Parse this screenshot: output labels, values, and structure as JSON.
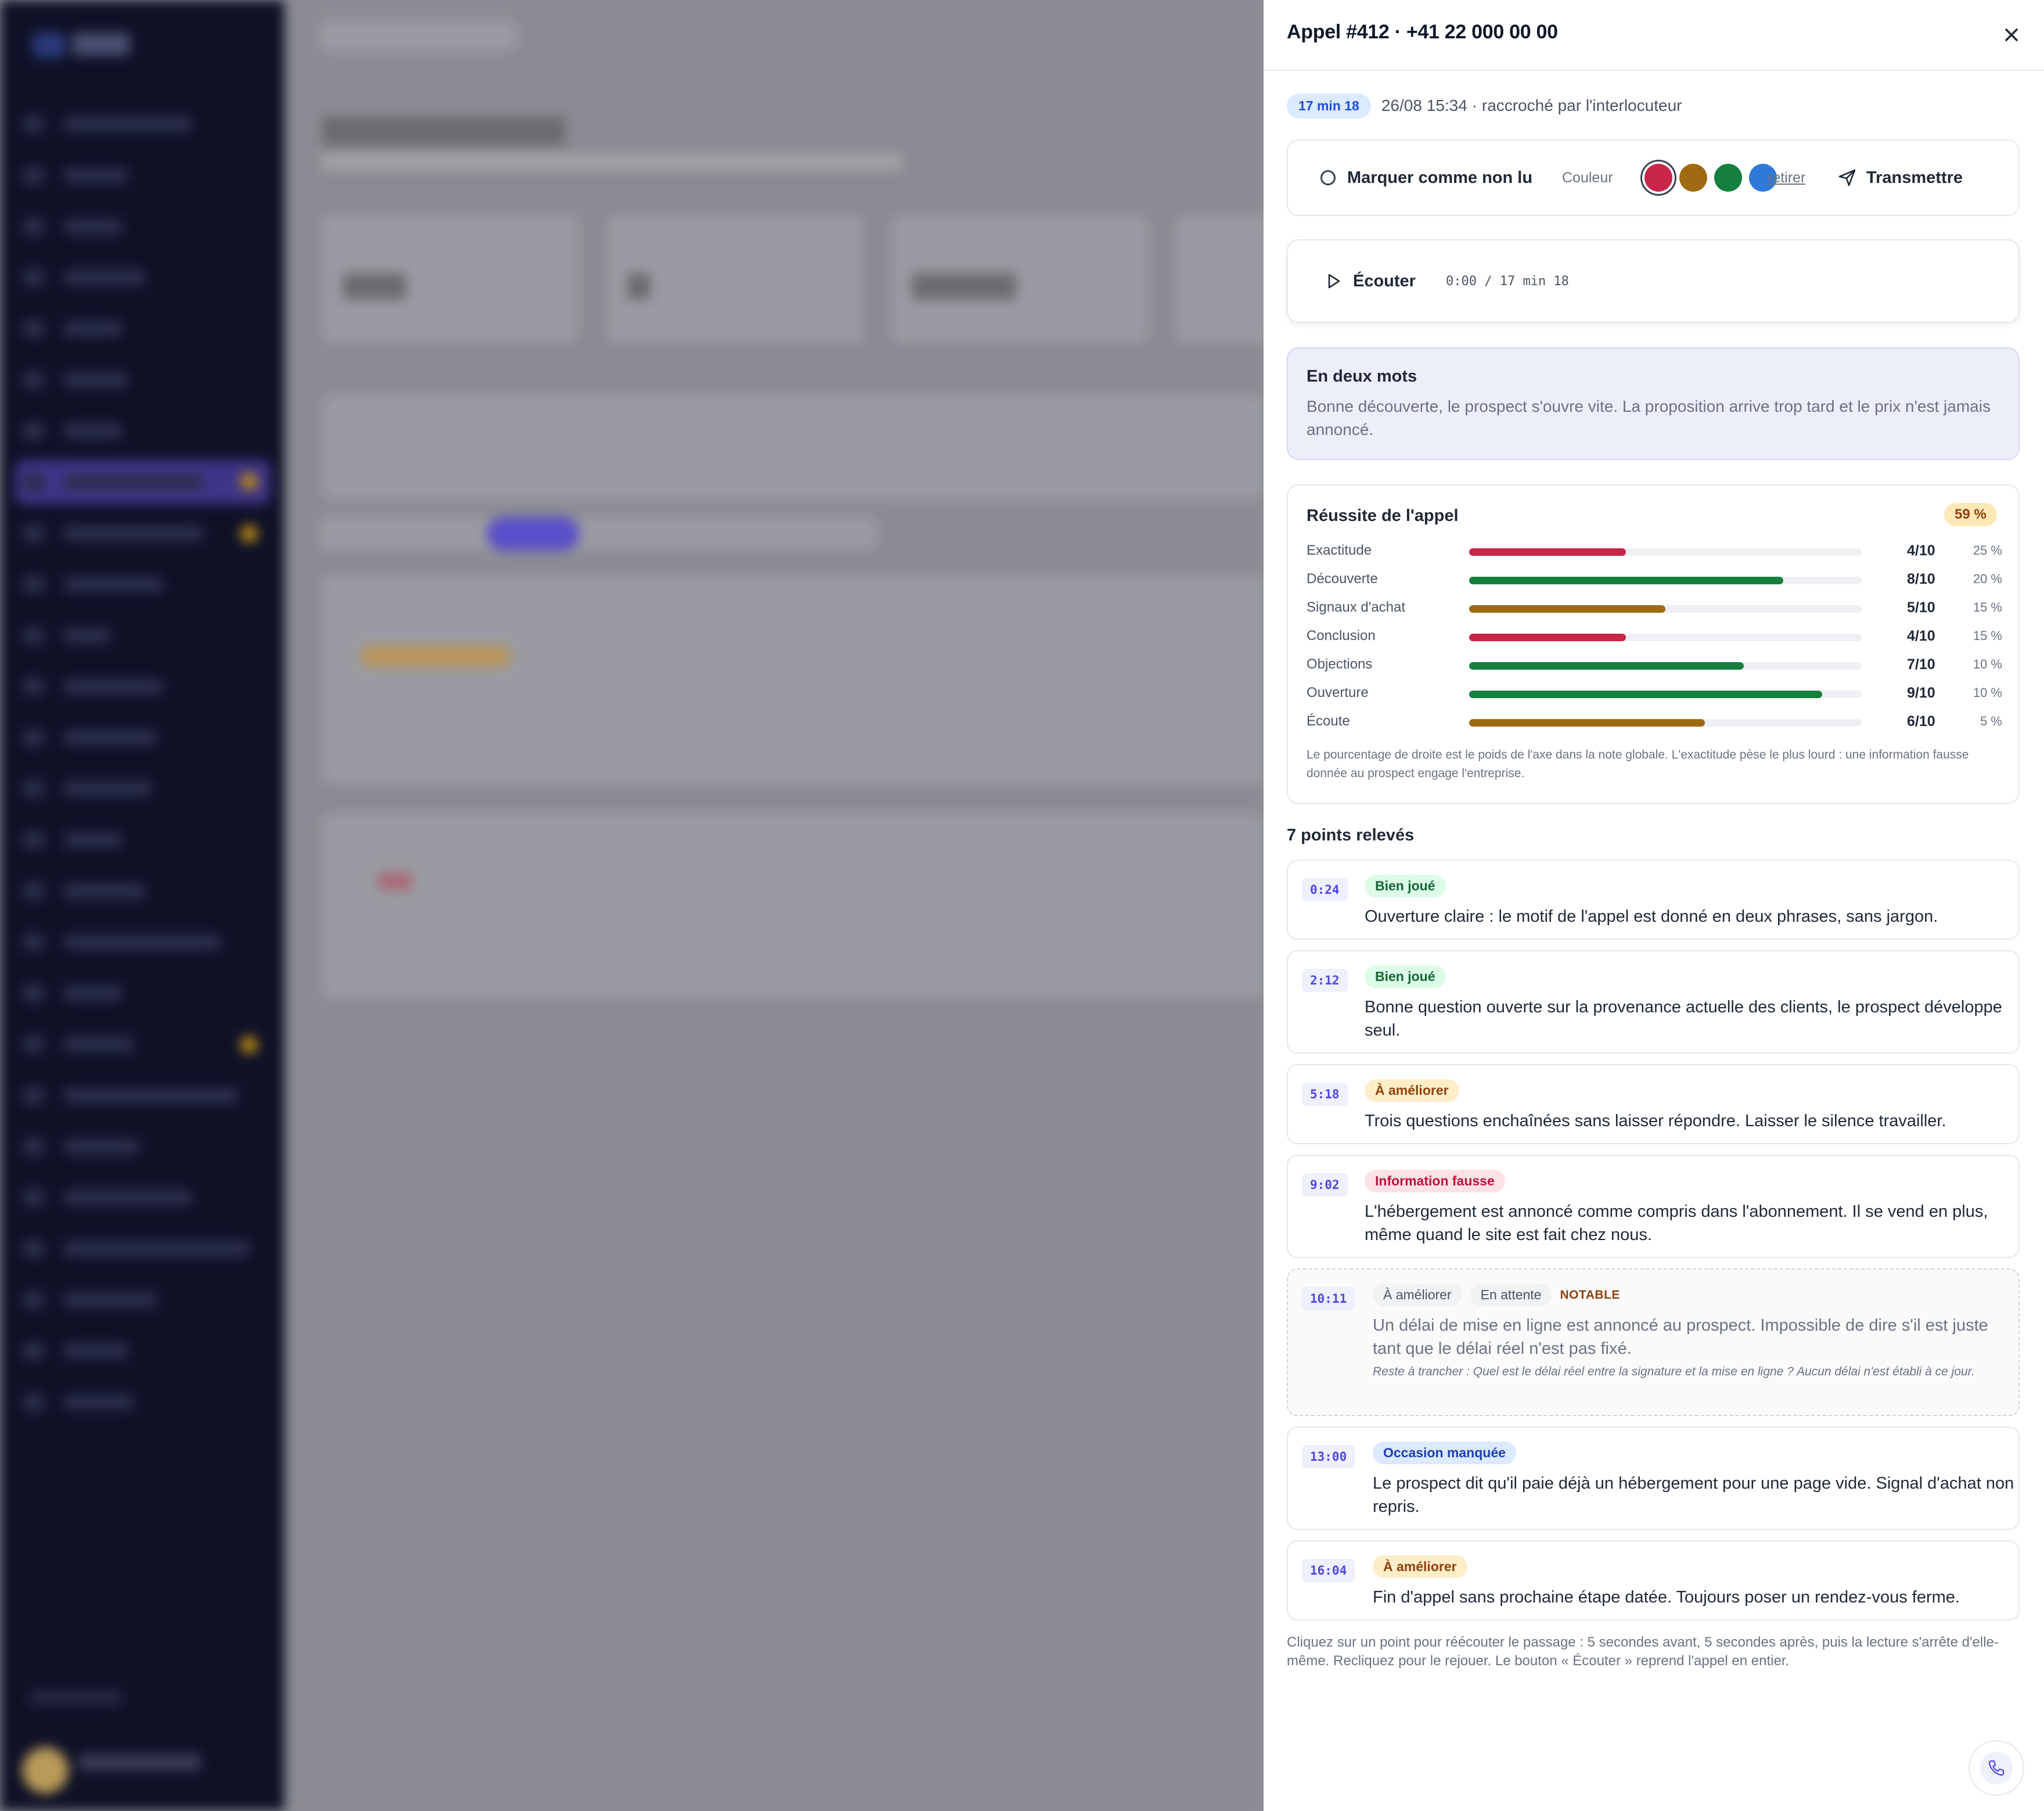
{
  "drawer": {
    "title": "Appel #412 · +41 22 000 00 00",
    "duration_badge": "17 min 18",
    "date": "26/08 15:34",
    "ended_by": "· raccroché par l'interlocuteur"
  },
  "actions": {
    "mark_unread": "Marquer comme non lu",
    "color_label": "Couleur",
    "colors": [
      "#c8254a",
      "#a06a12",
      "#15803d",
      "#2f7ad9"
    ],
    "selected_color_index": 0,
    "remove": "retirer",
    "forward": "Transmettre"
  },
  "player": {
    "listen_label": "Écouter",
    "time": "0:00 / 17 min 18"
  },
  "summary": {
    "title": "En deux mots",
    "text": "Bonne découverte, le prospect s'ouvre vite. La proposition arrive trop tard et le prix n'est jamais annoncé."
  },
  "score": {
    "title": "Réussite de l'appel",
    "total": "59 %",
    "axes": [
      {
        "label": "Exactitude",
        "score": 4,
        "value": "4/10",
        "weight": "25 %",
        "color": "#c8254a"
      },
      {
        "label": "Découverte",
        "score": 8,
        "value": "8/10",
        "weight": "20 %",
        "color": "#15803d"
      },
      {
        "label": "Signaux d'achat",
        "score": 5,
        "value": "5/10",
        "weight": "15 %",
        "color": "#a06a12"
      },
      {
        "label": "Conclusion",
        "score": 4,
        "value": "4/10",
        "weight": "15 %",
        "color": "#c8254a"
      },
      {
        "label": "Objections",
        "score": 7,
        "value": "7/10",
        "weight": "10 %",
        "color": "#15803d"
      },
      {
        "label": "Ouverture",
        "score": 9,
        "value": "9/10",
        "weight": "10 %",
        "color": "#15803d"
      },
      {
        "label": "Écoute",
        "score": 6,
        "value": "6/10",
        "weight": "5 %",
        "color": "#a06a12"
      }
    ],
    "note": "Le pourcentage de droite est le poids de l'axe dans la note globale. L'exactitude pèse le plus lourd : une information fausse donnée au prospect engage l'entreprise."
  },
  "points": {
    "title": "7 points relevés",
    "items": [
      {
        "time": "0:24",
        "tag": "Bien joué",
        "text": "Ouverture claire : le motif de l'appel est donné en deux phrases, sans jargon."
      },
      {
        "time": "2:12",
        "tag": "Bien joué",
        "text": "Bonne question ouverte sur la provenance actuelle des clients, le prospect développe seul."
      },
      {
        "time": "5:18",
        "tag": "À améliorer",
        "text": "Trois questions enchaînées sans laisser répondre. Laisser le silence travailler."
      },
      {
        "time": "9:02",
        "tag": "Information fausse",
        "text": "L'hébergement est annoncé comme compris dans l'abonnement. Il se vend en plus, même quand le site est fait chez nous."
      },
      {
        "time": "10:11",
        "tag": "À améliorer",
        "status": "En attente",
        "flag": "NOTABLE",
        "text": "Un délai de mise en ligne est annoncé au prospect. Impossible de dire s'il est juste tant que le délai réel n'est pas fixé.",
        "note": "Reste à trancher : Quel est le délai réel entre la signature et la mise en ligne ? Aucun délai n'est établi à ce jour."
      },
      {
        "time": "13:00",
        "tag": "Occasion manquée",
        "text": "Le prospect dit qu'il paie déjà un hébergement pour une page vide. Signal d'achat non repris."
      },
      {
        "time": "16:04",
        "tag": "À améliorer",
        "text": "Fin d'appel sans prochaine étape datée. Toujours poser un rendez-vous ferme."
      }
    ]
  },
  "footer": {
    "hint": "Cliquez sur un point pour réécouter le passage : 5 secondes avant, 5 secondes après, puis la lecture s'arrête d'elle-même. Recliquez pour le rejouer. Le bouton « Écouter » reprend l'appel en entier."
  },
  "icons": {
    "close": "close-icon",
    "mark_unread": "circle-icon",
    "forward": "send-icon",
    "play": "play-icon",
    "fab": "phone-icon"
  }
}
